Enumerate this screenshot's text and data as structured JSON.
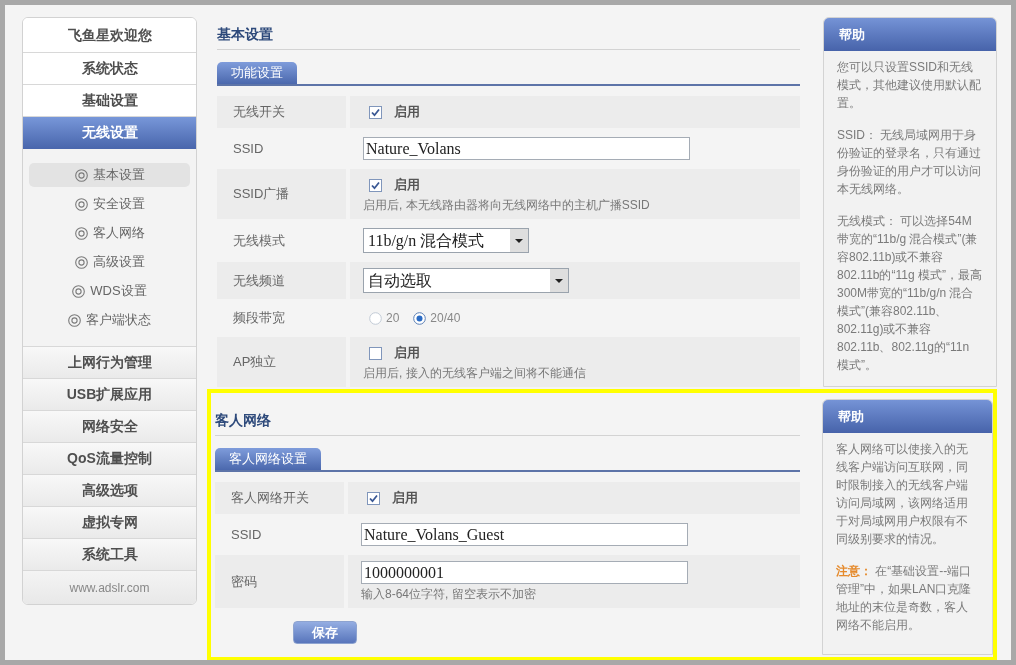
{
  "sidebar": {
    "items": [
      {
        "label": "飞鱼星欢迎您",
        "selected": false
      },
      {
        "label": "系统状态",
        "selected": false
      },
      {
        "label": "基础设置",
        "selected": false
      },
      {
        "label": "无线设置",
        "selected": true,
        "children": [
          {
            "label": "基本设置",
            "selected": true
          },
          {
            "label": "安全设置",
            "selected": false
          },
          {
            "label": "客人网络",
            "selected": false
          },
          {
            "label": "高级设置",
            "selected": false
          },
          {
            "label": "WDS设置",
            "selected": false
          },
          {
            "label": "客户端状态",
            "selected": false
          }
        ]
      },
      {
        "label": "上网行为管理",
        "selected": false
      },
      {
        "label": "USB扩展应用",
        "selected": false
      },
      {
        "label": "网络安全",
        "selected": false
      },
      {
        "label": "QoS流量控制",
        "selected": false
      },
      {
        "label": "高级选项",
        "selected": false
      },
      {
        "label": "虚拟专网",
        "selected": false
      },
      {
        "label": "系统工具",
        "selected": false
      }
    ],
    "footer": "www.adslr.com"
  },
  "basic_settings": {
    "title": "基本设置",
    "tab": "功能设置",
    "rows": [
      {
        "kind": "checkbox",
        "label": "无线开关",
        "checked": true,
        "option": "启用"
      },
      {
        "kind": "text",
        "label": "SSID",
        "value": "Nature_Volans"
      },
      {
        "kind": "checkbox",
        "label": "SSID广播",
        "checked": true,
        "option": "启用",
        "note": "启用后, 本无线路由器将向无线网络中的主机广播SSID"
      },
      {
        "kind": "select",
        "label": "无线模式",
        "value": "11b/g/n 混合模式"
      },
      {
        "kind": "select",
        "label": "无线频道",
        "value": "自动选取"
      },
      {
        "kind": "radio",
        "label": "频段带宽",
        "options": [
          {
            "label": "20",
            "selected": false
          },
          {
            "label": "20/40",
            "selected": true
          }
        ]
      },
      {
        "kind": "checkbox",
        "label": "AP独立",
        "checked": false,
        "option": "启用",
        "note": "启用后, 接入的无线客户端之间将不能通信"
      }
    ]
  },
  "basic_help": {
    "title": "帮助",
    "paragraphs": [
      "您可以只设置SSID和无线模式，其他建议使用默认配置。",
      "SSID：  无线局域网用于身份验证的登录名，只有通过身份验证的用户才可以访问本无线网络。",
      "无线模式：  可以选择54M带宽的“11b/g 混合模式”(兼容802.11b)或不兼容802.11b的“11g 模式”，最高300M带宽的“11b/g/n 混合模式”(兼容802.11b、802.11g)或不兼容802.11b、802.11g的“11n 模式”。"
    ]
  },
  "guest_network": {
    "title": "客人网络",
    "tab": "客人网络设置",
    "rows": [
      {
        "kind": "checkbox",
        "label": "客人网络开关",
        "checked": true,
        "option": "启用"
      },
      {
        "kind": "text",
        "label": "SSID",
        "value": "Nature_Volans_Guest"
      },
      {
        "kind": "text",
        "label": "密码",
        "value": "1000000001",
        "note": "输入8-64位字符, 留空表示不加密"
      }
    ],
    "save_button": "保存"
  },
  "guest_help": {
    "title": "帮助",
    "paragraphs": [
      "客人网络可以使接入的无线客户端访问互联网，同时限制接入的无线客户端访问局域网，该网络适用于对局域网用户权限有不同级别要求的情况。",
      "**注意：**  在“基础设置--端口管理”中，如果LAN口克隆地址的末位是奇数，客人网络不能启用。"
    ]
  }
}
